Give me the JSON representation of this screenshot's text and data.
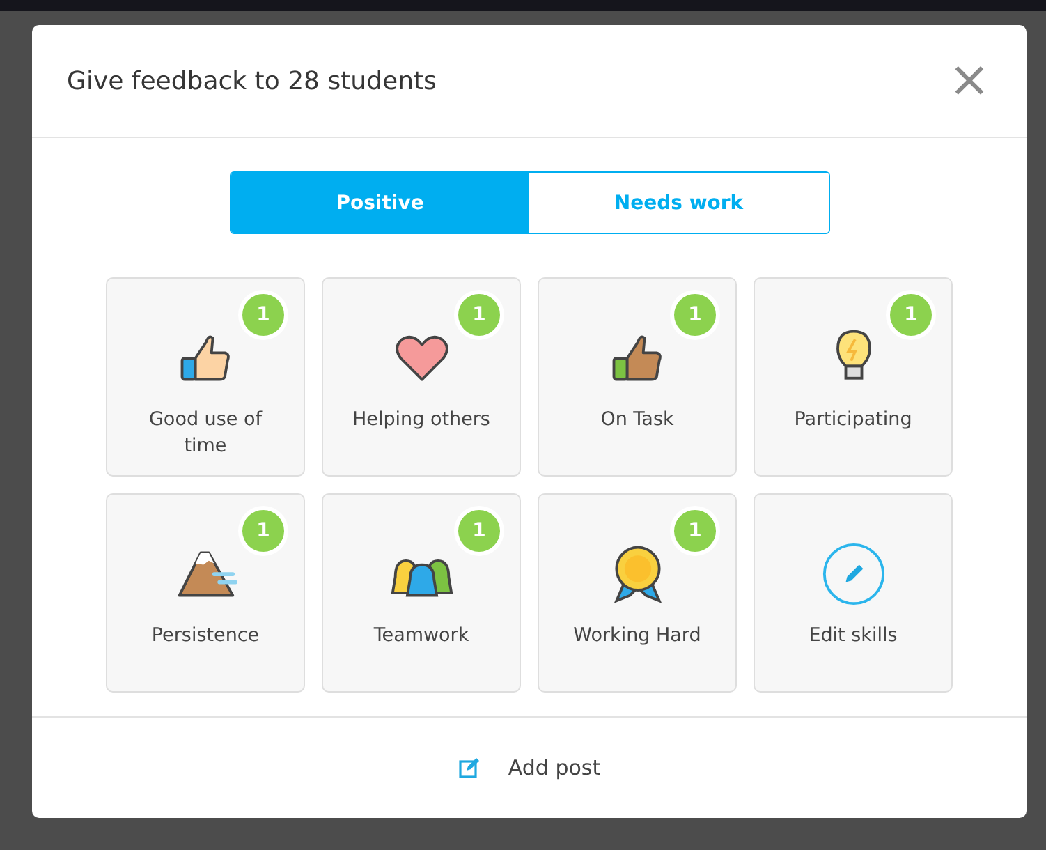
{
  "dialog": {
    "title": "Give feedback to 28 students",
    "close": "×"
  },
  "tabs": [
    {
      "label": "Positive",
      "selected": true
    },
    {
      "label": "Needs work",
      "selected": false
    }
  ],
  "skills": [
    {
      "kind": "skill",
      "label": "Good use of time",
      "count": "1"
    },
    {
      "kind": "skill",
      "label": "Helping others",
      "count": "1"
    },
    {
      "kind": "skill",
      "label": "On Task",
      "count": "1"
    },
    {
      "kind": "skill",
      "label": "Participating",
      "count": "1"
    },
    {
      "kind": "skill",
      "label": "Persistence",
      "count": "1"
    },
    {
      "kind": "skill",
      "label": "Teamwork",
      "count": "1"
    },
    {
      "kind": "skill",
      "label": "Working Hard",
      "count": "1"
    },
    {
      "kind": "edit",
      "label": "Edit skills"
    }
  ],
  "footer": {
    "action": "Add post"
  }
}
